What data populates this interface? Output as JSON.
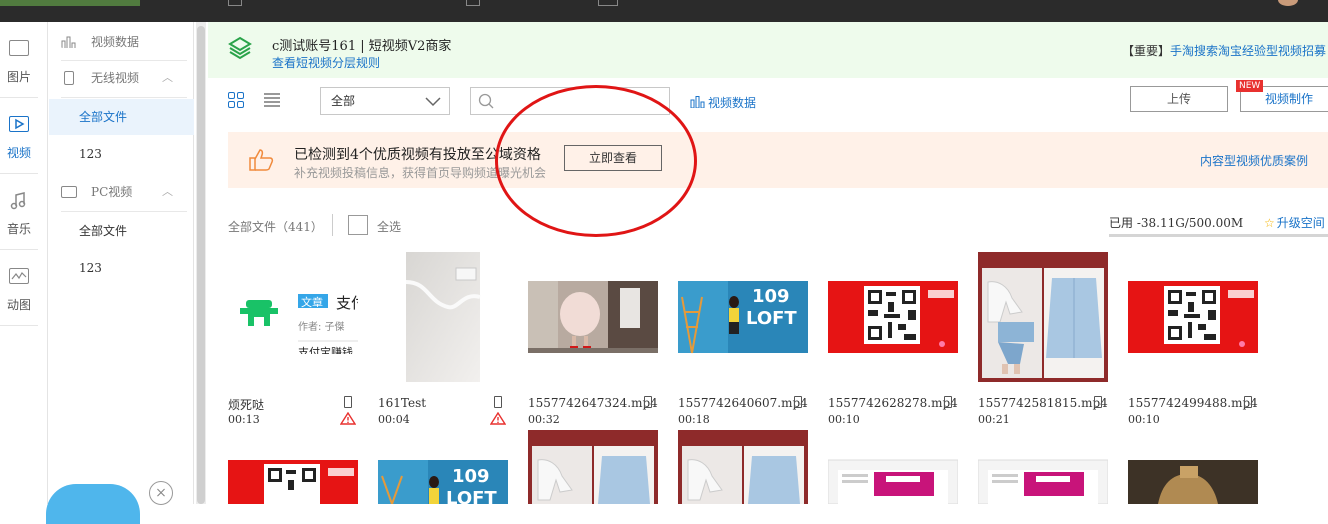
{
  "left_rail": {
    "items": [
      {
        "label": "图片",
        "icon": "image-icon"
      },
      {
        "label": "视频",
        "icon": "video-icon",
        "active": true
      },
      {
        "label": "音乐",
        "icon": "music-icon"
      },
      {
        "label": "动图",
        "icon": "gif-icon"
      }
    ]
  },
  "subnav": {
    "video_data": "视频数据",
    "wireless_video": "无线视频",
    "wireless_items": [
      "全部文件",
      "123"
    ],
    "pc_video": "PC视频",
    "pc_items": [
      "全部文件",
      "123"
    ]
  },
  "account": {
    "title": "c测试账号161  |  短视频V2商家",
    "link": "查看短视频分层规则",
    "notice_prefix": "【重要】",
    "notice_link": "手淘搜索淘宝经验型视频招募"
  },
  "toolbar": {
    "select_value": "全部",
    "search_placeholder": "",
    "video_data": "视频数据",
    "upload": "上传",
    "make": "视频制作",
    "new_badge": "NEW"
  },
  "banner": {
    "title": "已检测到4个优质视频有投放至公域资格",
    "subtitle": "补充视频投稿信息，获得首页导购频道曝光机会",
    "button": "立即查看",
    "case_link": "内容型视频优质案例"
  },
  "filebar": {
    "count": "全部文件（441）",
    "select_all": "全选",
    "used": "已用 -38.11G/500.00M",
    "upgrade": "升级空间"
  },
  "files": [
    {
      "name": "烦死哒",
      "duration": "00:13",
      "warn": true,
      "thumb": "alipay"
    },
    {
      "name": "161Test",
      "duration": "00:04",
      "warn": true,
      "thumb": "cable"
    },
    {
      "name": "1557742647324.mp4",
      "duration": "00:32",
      "warn": false,
      "thumb": "fashion"
    },
    {
      "name": "1557742640607.mp4",
      "duration": "00:18",
      "warn": false,
      "thumb": "loft"
    },
    {
      "name": "1557742628278.mp4",
      "duration": "00:10",
      "warn": false,
      "thumb": "qr"
    },
    {
      "name": "1557742581815.mp4",
      "duration": "00:21",
      "warn": false,
      "thumb": "denim"
    },
    {
      "name": "1557742499488.mp4",
      "duration": "00:10",
      "warn": false,
      "thumb": "qr"
    }
  ],
  "alipay_card": {
    "tag": "文章",
    "title": "支付",
    "author": "作者: 子傑",
    "caption": "支付宝赚钱"
  },
  "loft_text": {
    "num": "109",
    "word": "LOFT"
  },
  "colors": {
    "accent": "#1a73c8",
    "banner_bg": "#fff1e8",
    "account_bg": "#eefbec",
    "warn": "#e8312f",
    "circle": "#e01515"
  }
}
